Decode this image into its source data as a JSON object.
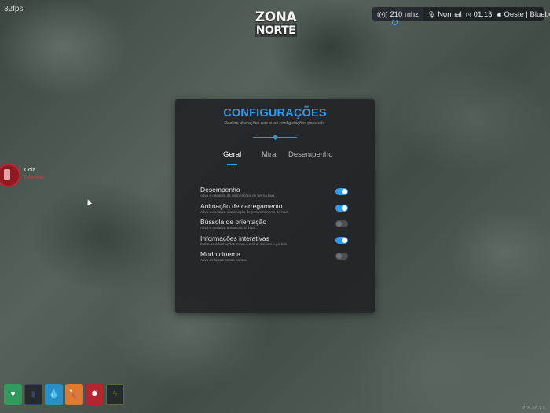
{
  "fps": "32fps",
  "logo": {
    "line1": "ZONA",
    "line2": "NORTE"
  },
  "hud": {
    "radio": "210 mhz",
    "mode": "Normal",
    "time": "01:13",
    "location": "Oeste | Blueberry"
  },
  "panel": {
    "title": "CONFIGURAÇÕES",
    "subtitle": "Realize alterações nas suas configurações pessoais.",
    "tabs": [
      {
        "label": "Geral",
        "active": true
      },
      {
        "label": "Mira",
        "active": false
      },
      {
        "label": "Desempenho",
        "active": false
      }
    ],
    "settings": [
      {
        "label": "Desempenho",
        "desc": "Ativa e desativa as informações de fps na hud.",
        "on": true
      },
      {
        "label": "Animação de carregamento",
        "desc": "Ativa e desativa a animação de preenchimento da hud.",
        "on": true
      },
      {
        "label": "Bússola de orientação",
        "desc": "Ativa e desativa a bússola da hud.",
        "on": false
      },
      {
        "label": "Informações interativas",
        "desc": "Exibe as informações sobre o status durante a partida.",
        "on": true
      },
      {
        "label": "Modo cinema",
        "desc": "Ativa as faixas pretas na tela.",
        "on": false
      }
    ]
  },
  "notification": {
    "title": "Cola",
    "subtitle": "Removido"
  },
  "status_icons": [
    {
      "name": "health",
      "glyph": "♥",
      "color": "#2f9a5c",
      "level": 1.0
    },
    {
      "name": "armor",
      "glyph": "▮",
      "color": "#2f4468",
      "level": 0.0
    },
    {
      "name": "water",
      "glyph": "💧",
      "color": "#2a8fc4",
      "level": 1.0
    },
    {
      "name": "food",
      "glyph": "🍗",
      "color": "#e07a2e",
      "level": 1.0
    },
    {
      "name": "stress",
      "glyph": "✹",
      "color": "#b32630",
      "level": 1.0
    },
    {
      "name": "stamina",
      "glyph": "ϟ",
      "color": "#5a6e2a",
      "level": 0.0
    }
  ],
  "watermark": "MTA:SA 1.6"
}
